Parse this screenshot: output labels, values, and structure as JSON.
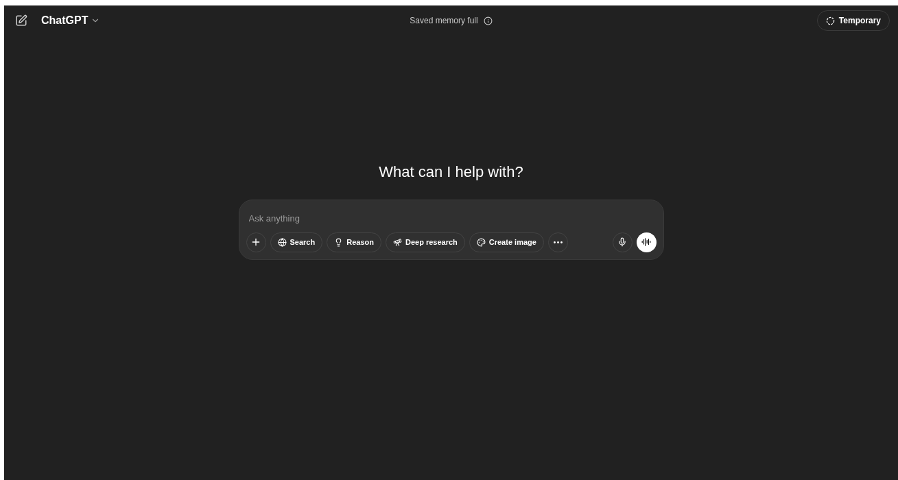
{
  "header": {
    "model": "ChatGPT",
    "notice": "Saved memory full",
    "temporary": "Temporary"
  },
  "heading": "What can I help with?",
  "composer": {
    "placeholder": "Ask anything",
    "tools": [
      {
        "kind": "search",
        "label": "Search"
      },
      {
        "kind": "reason",
        "label": "Reason"
      },
      {
        "kind": "research",
        "label": "Deep research"
      },
      {
        "kind": "image",
        "label": "Create image"
      }
    ]
  }
}
